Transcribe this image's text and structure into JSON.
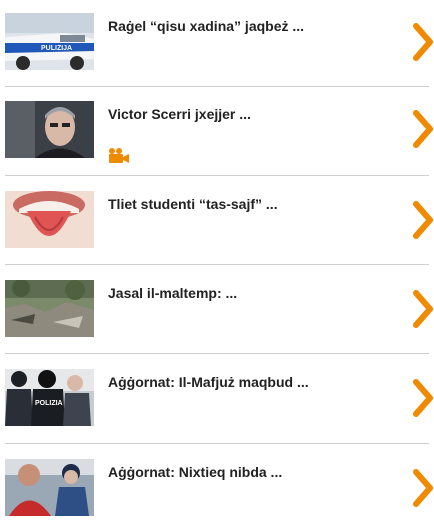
{
  "news": {
    "items": [
      {
        "title": "Raġel “qisu xadina” jaqbeż ...",
        "thumb": "police-car-photo"
      },
      {
        "title": "Victor Scerri jxejjer ...",
        "thumb": "man-portrait-photo",
        "badge": "video-camera-icon"
      },
      {
        "title": "Tliet studenti “tas-sajf” ...",
        "thumb": "tongue-photo"
      },
      {
        "title": "Jasal il-maltemp: ...",
        "thumb": "storm-debris-photo"
      },
      {
        "title": "Aġġornat: Il-Mafjuż maqbud ...",
        "thumb": "police-arrest-photo"
      },
      {
        "title": "Aġġornat: Nixtieq nibda ...",
        "thumb": "man-escorted-photo"
      }
    ]
  },
  "colors": {
    "accent": "#f08a00",
    "divider": "#cfcfcf",
    "text": "#222222"
  }
}
